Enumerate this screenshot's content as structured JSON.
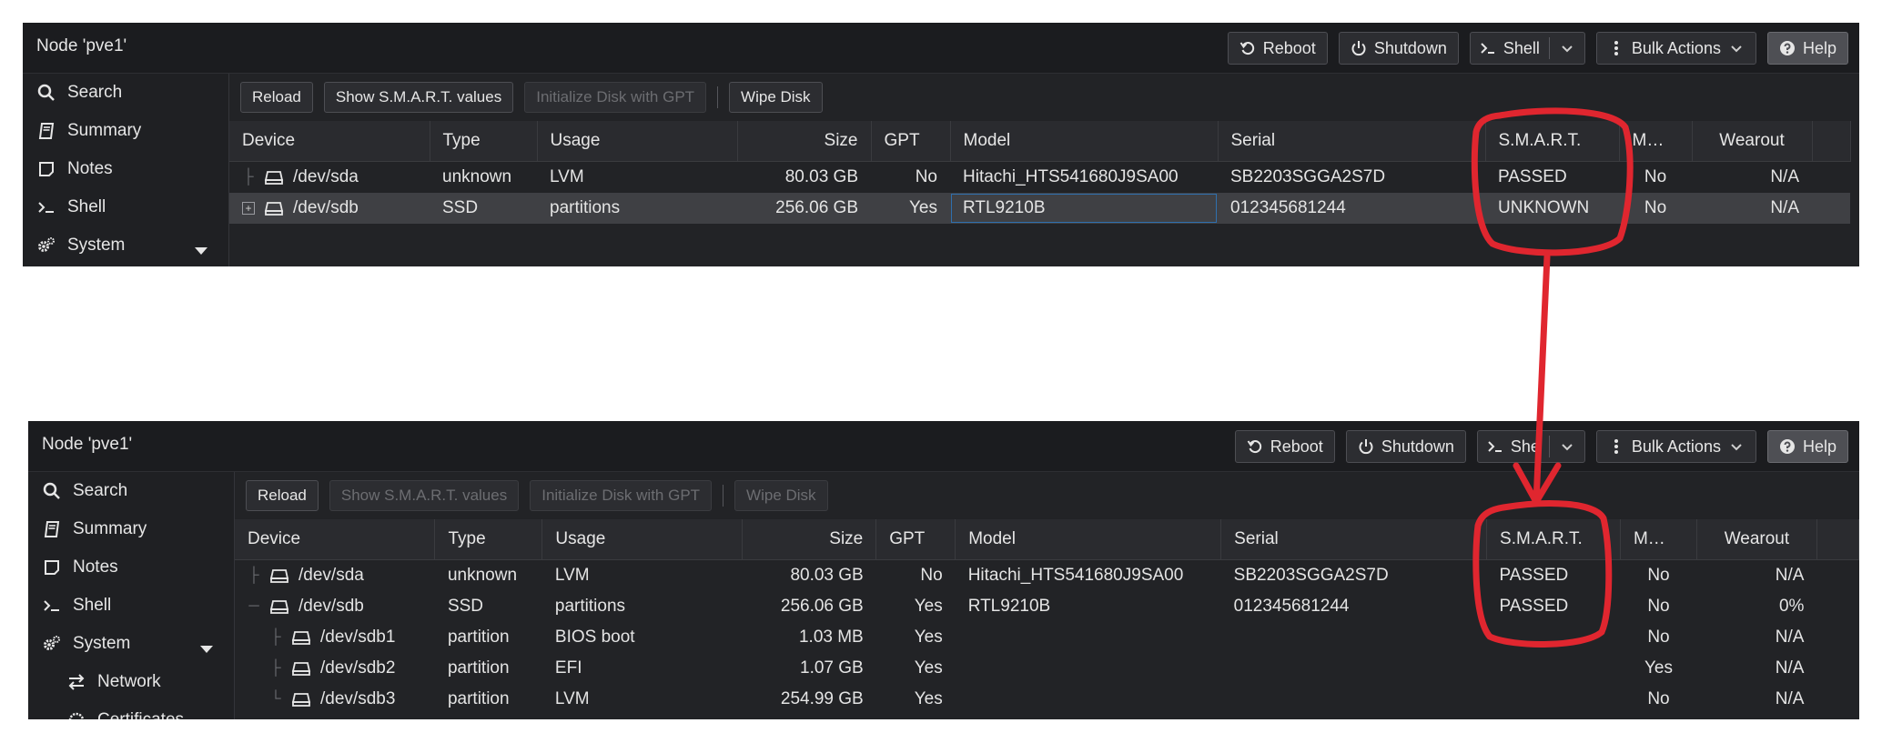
{
  "colors": {
    "panel_bg": "#222326",
    "header_bg": "#1b1c1f",
    "annotation_red": "#e0262f"
  },
  "panels": [
    {
      "node_title": "Node 'pve1'",
      "top_buttons": {
        "reboot": "Reboot",
        "shutdown": "Shutdown",
        "shell": "Shell",
        "bulk": "Bulk Actions",
        "help": "Help"
      },
      "sidebar": [
        "Search",
        "Summary",
        "Notes",
        "Shell",
        "System"
      ],
      "toolbar": {
        "reload": "Reload",
        "show_smart": "Show S.M.A.R.T. values",
        "init_gpt": "Initialize Disk with GPT",
        "wipe": "Wipe Disk"
      },
      "toolbar_disabled": {
        "show_smart": false,
        "init_gpt": true,
        "wipe": false
      },
      "columns": [
        "Device",
        "Type",
        "Usage",
        "Size",
        "GPT",
        "Model",
        "Serial",
        "S.M.A.R.T.",
        "M…",
        "Wearout"
      ],
      "rows": [
        {
          "device": "/dev/sda",
          "type": "unknown",
          "usage": "LVM",
          "size": "80.03 GB",
          "gpt": "No",
          "model": "Hitachi_HTS541680J9SA00",
          "serial": "SB2203SGGA2S7D",
          "smart": "PASSED",
          "m": "No",
          "wearout": "N/A"
        },
        {
          "device": "/dev/sdb",
          "type": "SSD",
          "usage": "partitions",
          "size": "256.06 GB",
          "gpt": "Yes",
          "model": "RTL9210B",
          "serial": "012345681244",
          "smart": "UNKNOWN",
          "m": "No",
          "wearout": "N/A"
        }
      ]
    },
    {
      "node_title": "Node 'pve1'",
      "top_buttons": {
        "reboot": "Reboot",
        "shutdown": "Shutdown",
        "shell": "She",
        "bulk": "Bulk Actions",
        "help": "Help"
      },
      "sidebar": [
        "Search",
        "Summary",
        "Notes",
        "Shell",
        "System",
        "Network",
        "Certificates"
      ],
      "toolbar": {
        "reload": "Reload",
        "show_smart": "Show S.M.A.R.T. values",
        "init_gpt": "Initialize Disk with GPT",
        "wipe": "Wipe Disk"
      },
      "toolbar_disabled": {
        "show_smart": true,
        "init_gpt": true,
        "wipe": true
      },
      "columns": [
        "Device",
        "Type",
        "Usage",
        "Size",
        "GPT",
        "Model",
        "Serial",
        "S.M.A.R.T.",
        "M…",
        "Wearout"
      ],
      "rows": [
        {
          "device": "/dev/sda",
          "type": "unknown",
          "usage": "LVM",
          "size": "80.03 GB",
          "gpt": "No",
          "model": "Hitachi_HTS541680J9SA00",
          "serial": "SB2203SGGA2S7D",
          "smart": "PASSED",
          "m": "No",
          "wearout": "N/A"
        },
        {
          "device": "/dev/sdb",
          "type": "SSD",
          "usage": "partitions",
          "size": "256.06 GB",
          "gpt": "Yes",
          "model": "RTL9210B",
          "serial": "012345681244",
          "smart": "PASSED",
          "m": "No",
          "wearout": "0%"
        },
        {
          "device": "/dev/sdb1",
          "type": "partition",
          "usage": "BIOS boot",
          "size": "1.03 MB",
          "gpt": "Yes",
          "model": "",
          "serial": "",
          "smart": "",
          "m": "No",
          "wearout": "N/A"
        },
        {
          "device": "/dev/sdb2",
          "type": "partition",
          "usage": "EFI",
          "size": "1.07 GB",
          "gpt": "Yes",
          "model": "",
          "serial": "",
          "smart": "",
          "m": "Yes",
          "wearout": "N/A"
        },
        {
          "device": "/dev/sdb3",
          "type": "partition",
          "usage": "LVM",
          "size": "254.99 GB",
          "gpt": "Yes",
          "model": "",
          "serial": "",
          "smart": "",
          "m": "No",
          "wearout": "N/A"
        }
      ]
    }
  ]
}
